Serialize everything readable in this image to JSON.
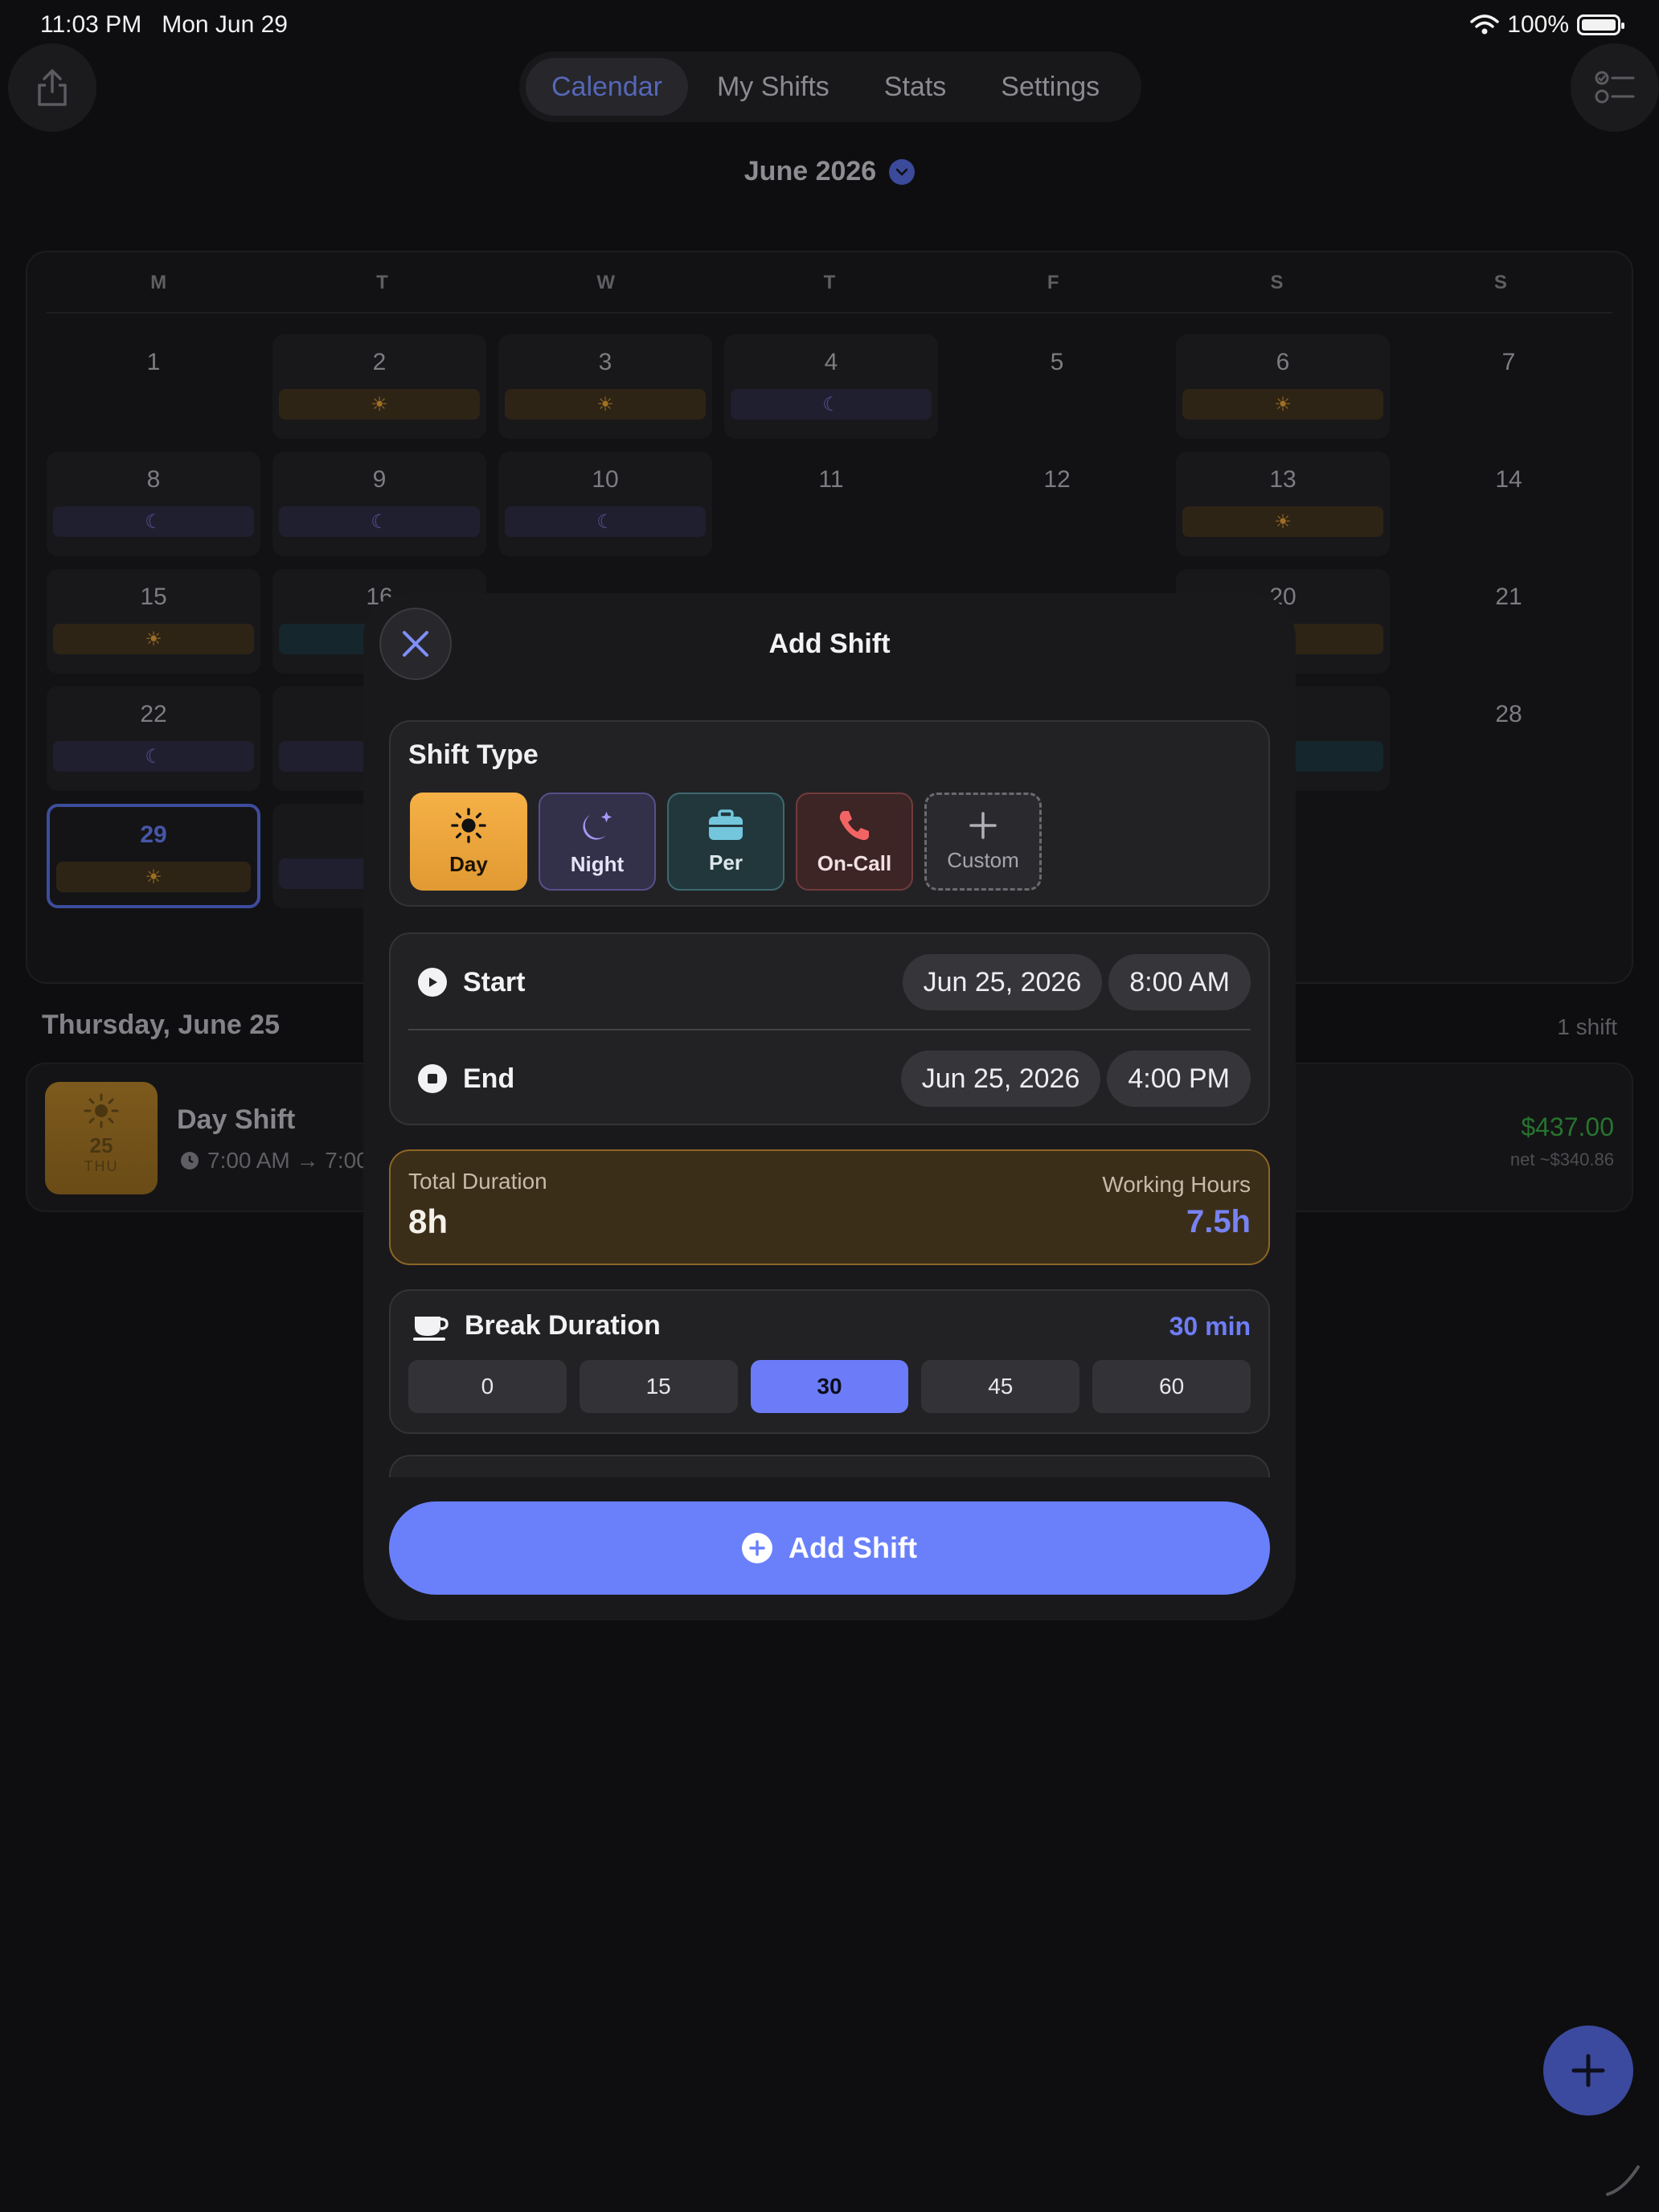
{
  "status": {
    "time": "11:03 PM",
    "date": "Mon Jun 29",
    "battery": "100%"
  },
  "nav": {
    "tabs": [
      {
        "label": "Calendar",
        "active": true
      },
      {
        "label": "My Shifts",
        "active": false
      },
      {
        "label": "Stats",
        "active": false
      },
      {
        "label": "Settings",
        "active": false
      }
    ],
    "share_icon": "share-icon",
    "checklist_icon": "checklist-icon"
  },
  "calendar": {
    "month": "June 2026",
    "weekdays": [
      "M",
      "T",
      "W",
      "T",
      "F",
      "S",
      "S"
    ],
    "days": [
      {
        "n": "1",
        "type": ""
      },
      {
        "n": "2",
        "type": "day"
      },
      {
        "n": "3",
        "type": "day"
      },
      {
        "n": "4",
        "type": "night"
      },
      {
        "n": "5",
        "type": ""
      },
      {
        "n": "6",
        "type": "day"
      },
      {
        "n": "7",
        "type": ""
      },
      {
        "n": "8",
        "type": "night"
      },
      {
        "n": "9",
        "type": "night"
      },
      {
        "n": "10",
        "type": "night"
      },
      {
        "n": "11",
        "type": ""
      },
      {
        "n": "12",
        "type": ""
      },
      {
        "n": "13",
        "type": "day"
      },
      {
        "n": "14",
        "type": ""
      },
      {
        "n": "15",
        "type": "day"
      },
      {
        "n": "16",
        "type": "per"
      },
      {
        "n": "",
        "type": ""
      },
      {
        "n": "",
        "type": ""
      },
      {
        "n": "",
        "type": ""
      },
      {
        "n": "20",
        "type": "day"
      },
      {
        "n": "21",
        "type": ""
      },
      {
        "n": "22",
        "type": "night"
      },
      {
        "n": "",
        "type": "night"
      },
      {
        "n": "",
        "type": ""
      },
      {
        "n": "",
        "type": ""
      },
      {
        "n": "",
        "type": ""
      },
      {
        "n": "",
        "type": "per"
      },
      {
        "n": "28",
        "type": ""
      },
      {
        "n": "29",
        "type": "day",
        "today": true
      },
      {
        "n": "",
        "type": "night"
      }
    ]
  },
  "selected_day": {
    "title": "Thursday, June 25",
    "count": "1 shift",
    "shift": {
      "name": "Day Shift",
      "thumb_day": "25",
      "thumb_dow": "THU",
      "time": "7:00 AM → 7:00",
      "amount": "$437.00",
      "net": "net ~$340.86"
    }
  },
  "sheet": {
    "title": "Add Shift",
    "shift_type": {
      "label": "Shift Type",
      "options": [
        {
          "label": "Day",
          "icon": "sun-icon",
          "selected": true
        },
        {
          "label": "Night",
          "icon": "moon-icon"
        },
        {
          "label": "Per",
          "icon": "briefcase-icon"
        },
        {
          "label": "On-Call",
          "icon": "phone-icon"
        },
        {
          "label": "Custom",
          "icon": "plus-icon"
        }
      ]
    },
    "start": {
      "label": "Start",
      "date": "Jun 25, 2026",
      "time": "8:00 AM"
    },
    "end": {
      "label": "End",
      "date": "Jun 25, 2026",
      "time": "4:00 PM"
    },
    "duration": {
      "label": "Total Duration",
      "value": "8h",
      "working_label": "Working Hours",
      "working_value": "7.5h"
    },
    "break": {
      "label": "Break Duration",
      "value": "30 min",
      "options": [
        "0",
        "15",
        "30",
        "45",
        "60"
      ],
      "selected": "30"
    },
    "submit": "Add Shift"
  },
  "colors": {
    "accent": "#6a80fb",
    "day": "#f0a840",
    "night": "#8b7ef0",
    "per": "#5fb3c8",
    "oncall": "#ef5a5a",
    "amount": "#27742f"
  }
}
